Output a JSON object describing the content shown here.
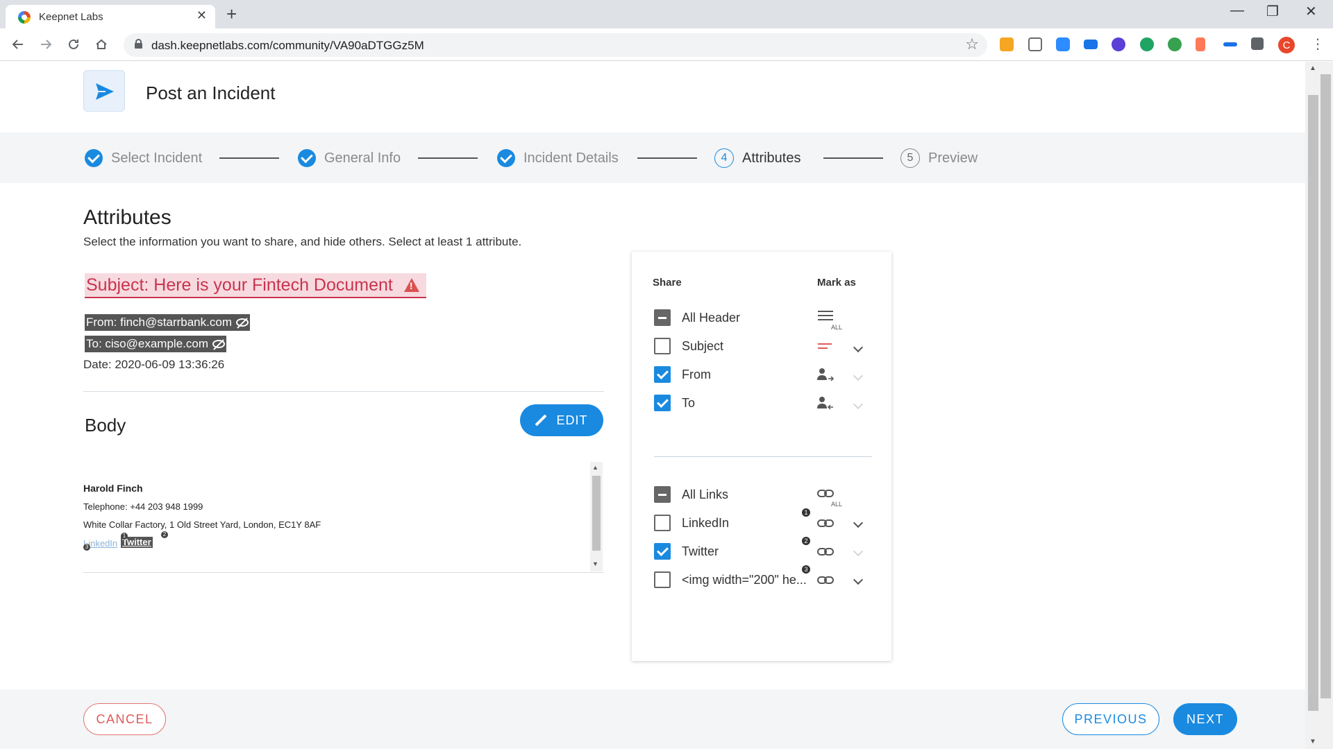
{
  "browser": {
    "tab_title": "Keepnet Labs",
    "tab_close": "✕",
    "new_tab": "+",
    "url": "dash.keepnetlabs.com/community/VA90aDTGGz5M",
    "minimize": "—",
    "maximize": "❐",
    "close": "✕",
    "profile_initial": "C",
    "ext_colors": [
      "#f5a623",
      "#6b6b6b",
      "#2d8cff",
      "#1a73e8",
      "#5b3fd6",
      "#1fa463",
      "#37a150",
      "#ff7a59",
      "#1a73e8"
    ]
  },
  "header": {
    "title": "Post an Incident",
    "accent": "#1a8ae0"
  },
  "stepper": {
    "steps": [
      {
        "label": "Select Incident",
        "state": "done"
      },
      {
        "label": "General Info",
        "state": "done"
      },
      {
        "label": "Incident Details",
        "state": "done"
      },
      {
        "label": "Attributes",
        "number": "4",
        "state": "active"
      },
      {
        "label": "Preview",
        "number": "5",
        "state": "pending"
      }
    ]
  },
  "attributes": {
    "title": "Attributes",
    "description": "Select the information you want to share, and hide others. Select at least 1 attribute.",
    "subject": "Subject: Here is your Fintech Document",
    "from": "From: finch@starrbank.com",
    "to": "To: ciso@example.com",
    "date": "Date: 2020-06-09 13:36:26"
  },
  "body": {
    "title": "Body",
    "edit_label": "EDIT",
    "name": "Harold Finch",
    "telephone": "Telephone: +44 203 948 1999",
    "address": "White Collar Factory, 1 Old Street Yard, London, EC1Y 8AF",
    "link_linkedin": "LinkedIn",
    "link_twitter": "Twitter",
    "badge_1": "1",
    "badge_2": "2",
    "badge_3": "3"
  },
  "panel": {
    "share_header": "Share",
    "mark_header": "Mark as",
    "header_rows": [
      {
        "label": "All Header",
        "state": "indeterminate"
      },
      {
        "label": "Subject",
        "state": "unchecked"
      },
      {
        "label": "From",
        "state": "checked"
      },
      {
        "label": "To",
        "state": "checked"
      }
    ],
    "link_rows": [
      {
        "label": "All Links",
        "state": "indeterminate"
      },
      {
        "label": "LinkedIn",
        "state": "unchecked",
        "badge": "1"
      },
      {
        "label": "Twitter",
        "state": "checked",
        "badge": "2"
      },
      {
        "label": "<img width=\"200\" he...",
        "state": "unchecked",
        "badge": "3"
      }
    ],
    "all_tag": "ALL"
  },
  "footer": {
    "cancel": "CANCEL",
    "previous": "PREVIOUS",
    "next": "NEXT"
  }
}
